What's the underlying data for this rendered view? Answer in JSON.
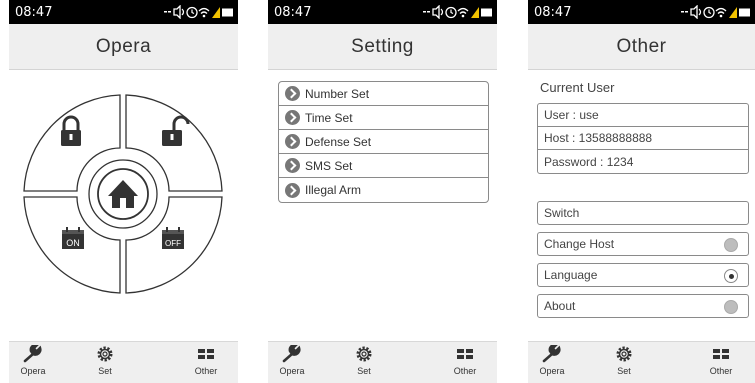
{
  "status_bar": {
    "time": "08:47"
  },
  "tab_bar": {
    "tabs": [
      {
        "label": "Opera",
        "icon": "wrench-icon"
      },
      {
        "label": "Set",
        "icon": "gear-icon"
      },
      {
        "label": "Other",
        "icon": "grid-icon"
      }
    ]
  },
  "screens": {
    "opera": {
      "title": "Opera",
      "buttons": {
        "lock_icon": "lock-icon",
        "unlock_icon": "unlock-icon",
        "home_icon": "home-icon",
        "on_label": "ON",
        "off_label": "OFF"
      }
    },
    "setting": {
      "title": "Setting",
      "items": [
        "Number Set",
        "Time Set",
        "Defense Set",
        "SMS Set",
        "Illegal Arm"
      ]
    },
    "other": {
      "title": "Other",
      "current_user_title": "Current User",
      "user": "User : use",
      "host": "Host : 13588888888",
      "password": "Password : 1234",
      "options": [
        {
          "label": "Switch",
          "radio": "none"
        },
        {
          "label": "Change Host",
          "radio": "off"
        },
        {
          "label": "Language",
          "radio": "on"
        },
        {
          "label": "About",
          "radio": "off"
        }
      ]
    }
  },
  "colors": {
    "status_bar": "#000000",
    "title_bar": "#efefef",
    "border": "#8a8a8a",
    "icon": "#333333"
  }
}
